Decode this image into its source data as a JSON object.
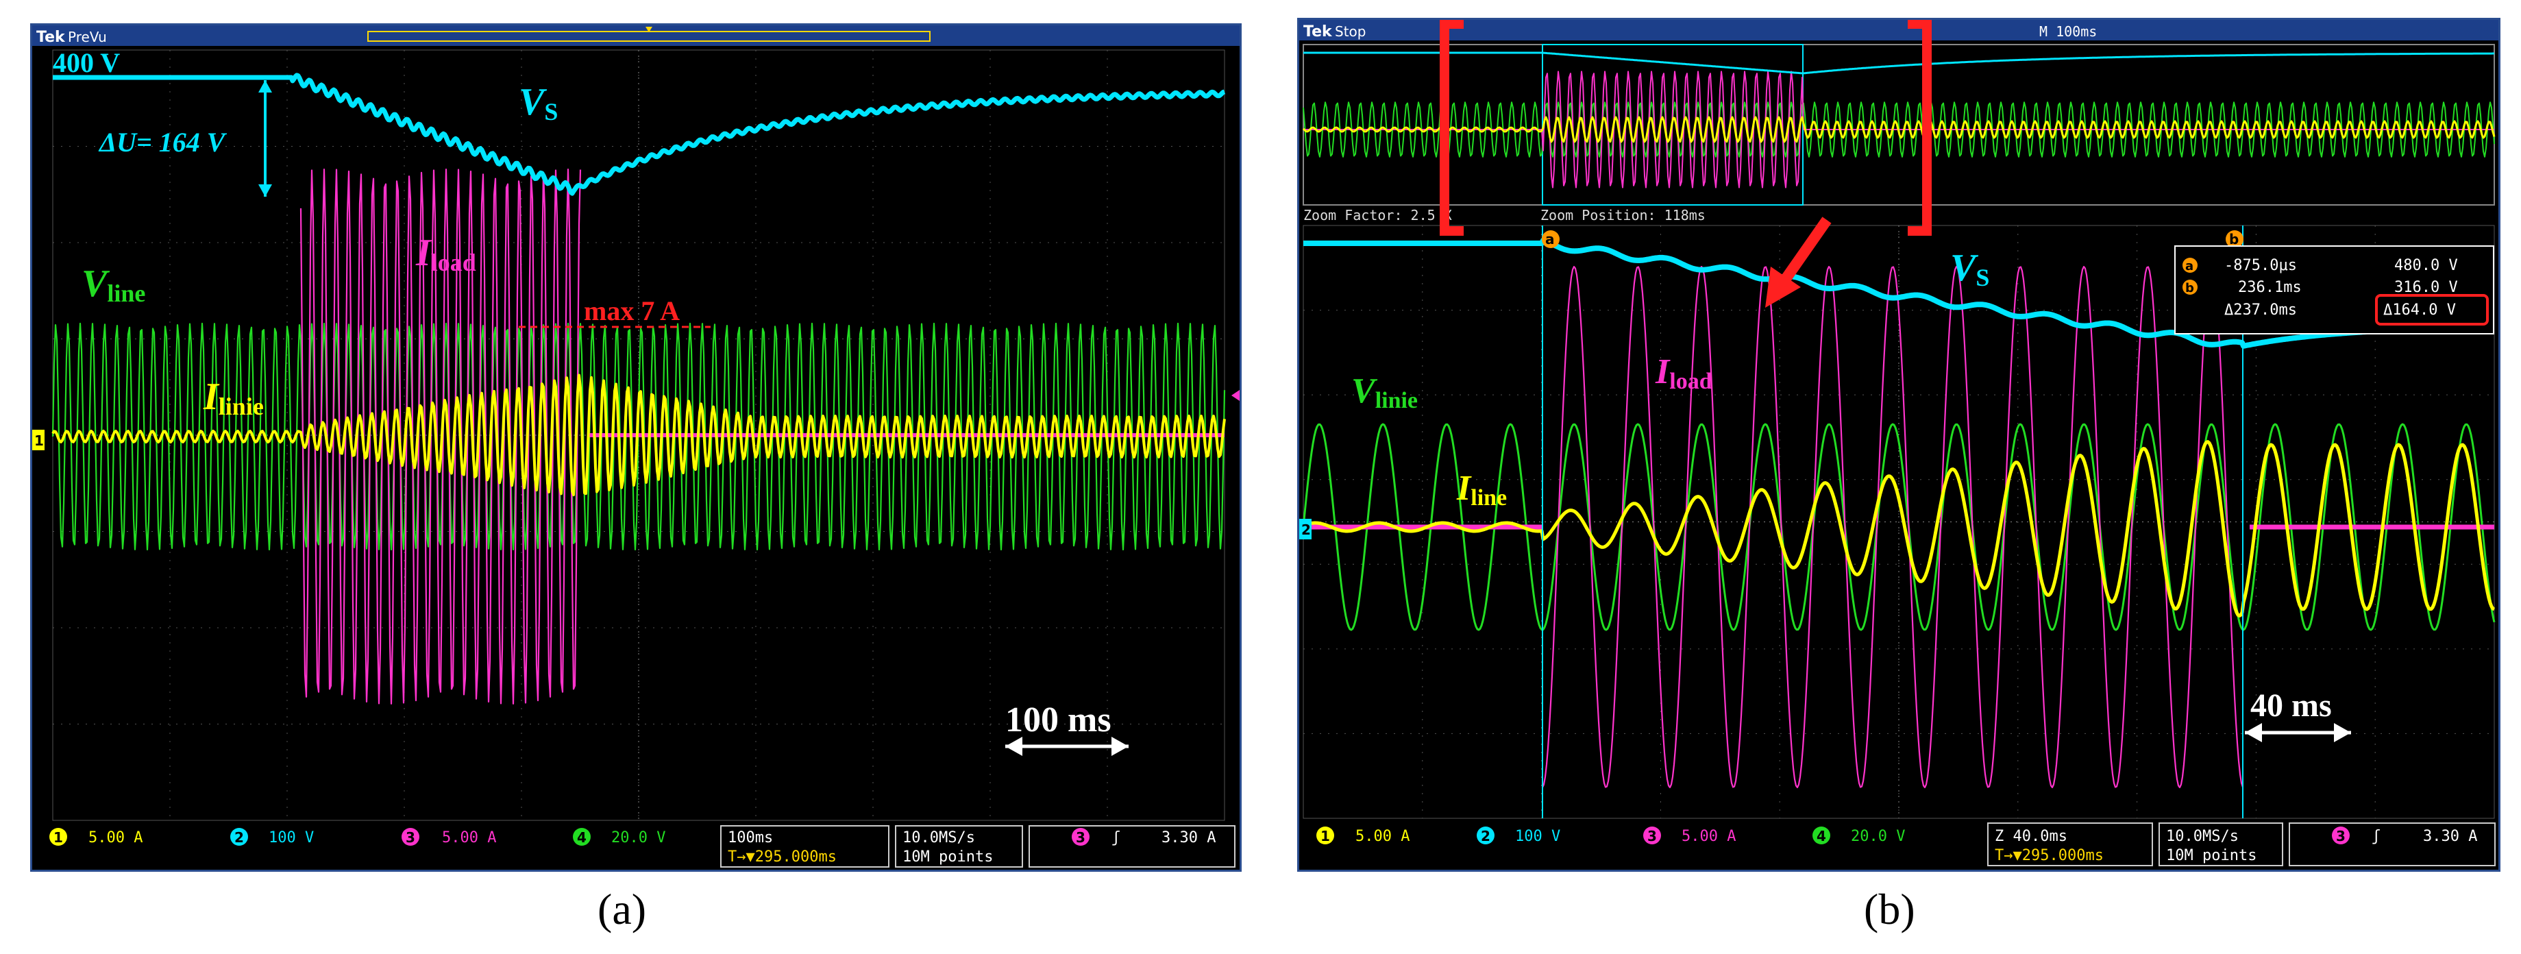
{
  "colors": {
    "ch1": "#ffff00",
    "ch2": "#00e5ff",
    "ch3": "#ff33cc",
    "ch4": "#22dd22",
    "annotation_red": "#ff2020",
    "frame": "#2a4d8f",
    "grid": "#555555"
  },
  "captions": {
    "a": "(a)",
    "b": "(b)"
  },
  "panel_a": {
    "header": {
      "logo": "Tek",
      "mode": "PreVu"
    },
    "labels": {
      "v_start": "400 V",
      "delta_u": "ΔU= 164 V",
      "vs": "V",
      "vs_sub": "S",
      "iload": "I",
      "iload_sub": "load",
      "vline": "V",
      "vline_sub": "line",
      "iline": "I",
      "iline_sub": "linie",
      "max": "max 7 A",
      "timescale": "100 ms"
    },
    "footer": {
      "ch1": "5.00 A",
      "ch2": "100 V",
      "ch3": "5.00 A",
      "ch4": "20.0 V",
      "timebase": "100ms",
      "trig_pos": "T→▼295.000ms",
      "rate": "10.0MS/s",
      "points": "10M points",
      "trig_ch": "3",
      "trig_slope": "ʃ",
      "trig_level": "3.30 A"
    }
  },
  "panel_b": {
    "header": {
      "logo": "Tek",
      "mode": "Stop",
      "timebase": "M 100ms"
    },
    "zoom": {
      "factor_label": "Zoom Factor: 2.5 X",
      "position_label": "Zoom Position: 118ms"
    },
    "cursors": {
      "a_label": "a",
      "b_label": "b",
      "a_time": "-875.0μs",
      "a_volt": "480.0 V",
      "b_time": "236.1ms",
      "b_volt": "316.0 V",
      "d_time": "Δ237.0ms",
      "d_volt": "Δ164.0 V"
    },
    "labels": {
      "vs": "V",
      "vs_sub": "S",
      "iload": "I",
      "iload_sub": "load",
      "vline": "V",
      "vline_sub": "linie",
      "iline": "I",
      "iline_sub": "line",
      "timescale": "40 ms"
    },
    "footer": {
      "ch1": "5.00 A",
      "ch2": "100 V",
      "ch3": "5.00 A",
      "ch4": "20.0 V",
      "timebase": "Z 40.0ms",
      "trig_pos": "T→▼295.000ms",
      "rate": "10.0MS/s",
      "points": "10M points",
      "trig_ch": "3",
      "trig_slope": "ʃ",
      "trig_level": "3.30 A"
    }
  },
  "chart_data": [
    {
      "type": "line",
      "title": "",
      "time_per_div_ms": 100,
      "series": [
        {
          "name": "V",
          "channel": 2,
          "scale": "100 V/div",
          "start": 400,
          "min": 236,
          "drop": 164
        },
        {
          "name": "I",
          "channel": 3,
          "scale": "5.00 A/div",
          "peak": 7
        },
        {
          "name": "V",
          "channel": 4,
          "scale": "20.0 V/div"
        },
        {
          "name": "I",
          "channel": 1,
          "scale": "5.00 A/div"
        }
      ]
    },
    {
      "type": "line",
      "title": "",
      "time_per_div_ms": 40,
      "cursor_a": {
        "t_ms": -0.875,
        "v": 480.0
      },
      "cursor_b": {
        "t_ms": 236.1,
        "v": 316.0
      },
      "delta": {
        "t_ms": 237.0,
        "v": 164.0
      }
    }
  ]
}
